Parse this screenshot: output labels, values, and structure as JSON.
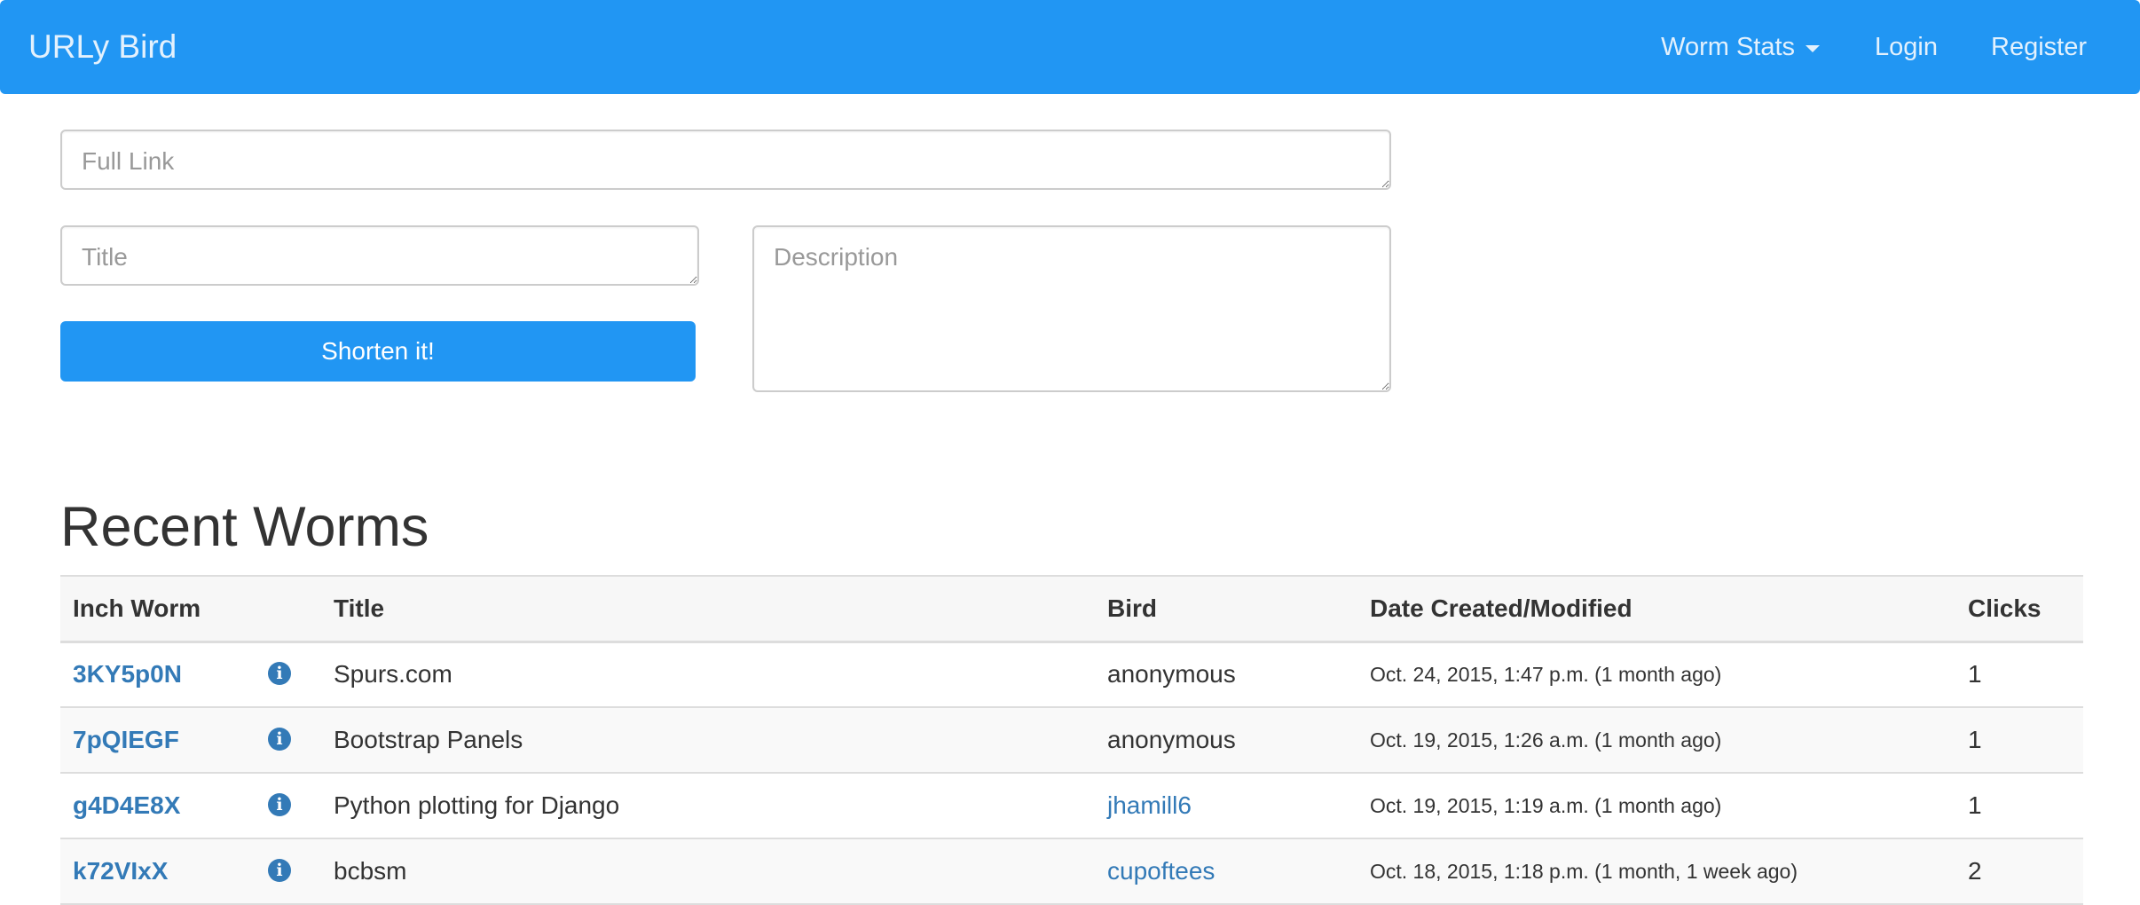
{
  "navbar": {
    "brand": "URLy Bird",
    "dropdown_label": "Worm Stats",
    "login_label": "Login",
    "register_label": "Register"
  },
  "form": {
    "full_link_placeholder": "Full Link",
    "title_placeholder": "Title",
    "description_placeholder": "Description",
    "submit_label": "Shorten it!"
  },
  "recent": {
    "heading": "Recent Worms",
    "columns": {
      "code": "Inch Worm",
      "title": "Title",
      "bird": "Bird",
      "date": "Date Created/Modified",
      "clicks": "Clicks"
    },
    "rows": [
      {
        "code": "3KY5p0N",
        "title": "Spurs.com",
        "bird": "anonymous",
        "bird_is_link": false,
        "date": "Oct. 24, 2015, 1:47 p.m. (1 month ago)",
        "clicks": "1"
      },
      {
        "code": "7pQIEGF",
        "title": "Bootstrap Panels",
        "bird": "anonymous",
        "bird_is_link": false,
        "date": "Oct. 19, 2015, 1:26 a.m. (1 month ago)",
        "clicks": "1"
      },
      {
        "code": "g4D4E8X",
        "title": "Python plotting for Django",
        "bird": "jhamill6",
        "bird_is_link": true,
        "date": "Oct. 19, 2015, 1:19 a.m. (1 month ago)",
        "clicks": "1"
      },
      {
        "code": "k72VIxX",
        "title": "bcbsm",
        "bird": "cupoftees",
        "bird_is_link": true,
        "date": "Oct. 18, 2015, 1:18 p.m. (1 month, 1 week ago)",
        "clicks": "2"
      }
    ]
  },
  "colors": {
    "brand_blue": "#2196f3",
    "link_blue": "#337ab7"
  },
  "icons": {
    "info": "info-circle-icon",
    "dropdown": "caret-down-icon"
  }
}
